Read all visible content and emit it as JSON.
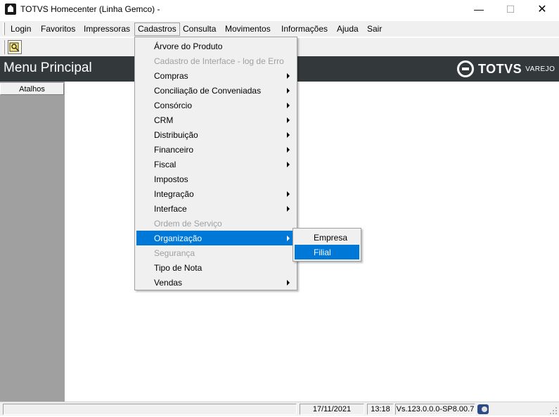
{
  "window": {
    "title": "TOTVS Homecenter (Linha Gemco) -",
    "minimize": "—",
    "maximize": "☐",
    "close": "✕"
  },
  "menubar": {
    "items": [
      "Login",
      "Favoritos",
      "Impressoras",
      "Cadastros",
      "Consulta",
      "Movimentos",
      "Informações",
      "Ajuda",
      "Sair"
    ],
    "active": "Cadastros"
  },
  "toolbar": {
    "button_icon": "key-icon"
  },
  "header": {
    "title": "Menu Principal",
    "brand_name": "TOTVS",
    "brand_sub": "VAREJO"
  },
  "sidebar": {
    "tab_label": "Atalhos"
  },
  "cadastros_menu": {
    "items": [
      {
        "label": "Árvore do Produto",
        "enabled": true,
        "submenu": false
      },
      {
        "label": "Cadastro de Interface - log de Erro",
        "enabled": false,
        "submenu": false
      },
      {
        "label": "Compras",
        "enabled": true,
        "submenu": true
      },
      {
        "label": "Conciliação de Conveniadas",
        "enabled": true,
        "submenu": true
      },
      {
        "label": "Consórcio",
        "enabled": true,
        "submenu": true
      },
      {
        "label": "CRM",
        "enabled": true,
        "submenu": true
      },
      {
        "label": "Distribuição",
        "enabled": true,
        "submenu": true
      },
      {
        "label": "Financeiro",
        "enabled": true,
        "submenu": true
      },
      {
        "label": "Fiscal",
        "enabled": true,
        "submenu": true
      },
      {
        "label": "Impostos",
        "enabled": true,
        "submenu": false
      },
      {
        "label": "Integração",
        "enabled": true,
        "submenu": true
      },
      {
        "label": "Interface",
        "enabled": true,
        "submenu": true
      },
      {
        "label": "Ordem de Serviço",
        "enabled": false,
        "submenu": false
      },
      {
        "label": "Organização",
        "enabled": true,
        "submenu": true,
        "highlighted": true
      },
      {
        "label": "Segurança",
        "enabled": false,
        "submenu": false
      },
      {
        "label": "Tipo de Nota",
        "enabled": true,
        "submenu": false
      },
      {
        "label": "Vendas",
        "enabled": true,
        "submenu": true
      }
    ]
  },
  "organizacao_submenu": {
    "items": [
      {
        "label": "Empresa",
        "highlighted": false
      },
      {
        "label": "Filial",
        "highlighted": true
      }
    ]
  },
  "statusbar": {
    "date": "17/11/2021",
    "time": "13:18",
    "version": "Vs.123.0.0.0-SP8.00.7"
  },
  "colors": {
    "highlight": "#0078d7",
    "header_bg": "#33383b",
    "sidebar_bg": "#a0a0a0"
  }
}
